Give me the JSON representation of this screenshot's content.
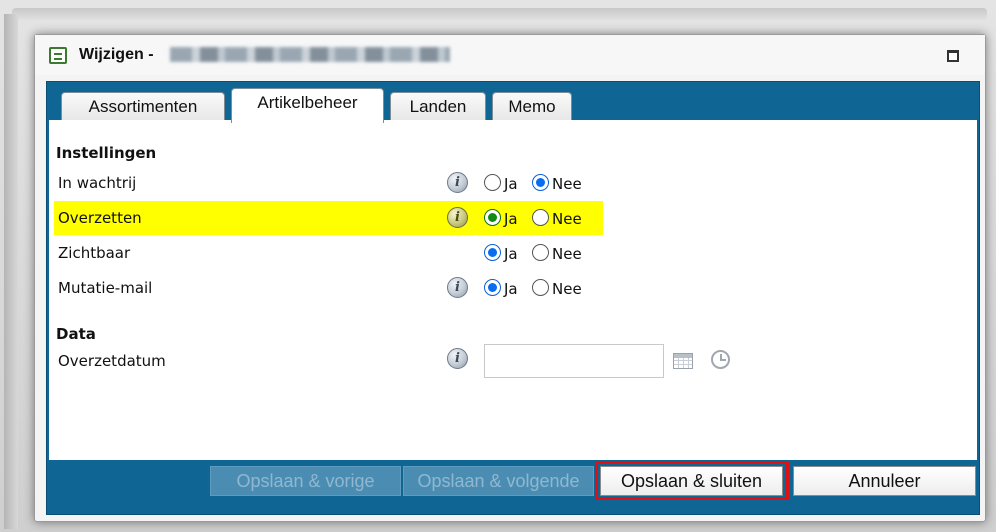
{
  "window": {
    "title": "Wijzigen -",
    "maximize_label": ""
  },
  "tabs": [
    {
      "label": "Assortimenten",
      "active": false
    },
    {
      "label": "Artikelbeheer",
      "active": true
    },
    {
      "label": "Landen",
      "active": false
    },
    {
      "label": "Memo",
      "active": false
    }
  ],
  "sections": {
    "settings_title": "Instellingen",
    "data_title": "Data"
  },
  "settings": [
    {
      "label": "In wachtrij",
      "info": true,
      "yes_label": "Ja",
      "no_label": "Nee",
      "value": "Nee",
      "highlight": false
    },
    {
      "label": "Overzetten",
      "info": true,
      "yes_label": "Ja",
      "no_label": "Nee",
      "value": "Ja",
      "highlight": true
    },
    {
      "label": "Zichtbaar",
      "info": false,
      "yes_label": "Ja",
      "no_label": "Nee",
      "value": "Ja",
      "highlight": false
    },
    {
      "label": "Mutatie-mail",
      "info": true,
      "yes_label": "Ja",
      "no_label": "Nee",
      "value": "Ja",
      "highlight": false
    }
  ],
  "data_fields": {
    "overzetdatum_label": "Overzetdatum",
    "overzetdatum_value": ""
  },
  "footer": {
    "save_prev": "Opslaan & vorige",
    "save_next": "Opslaan & volgende",
    "save_close": "Opslaan & sluiten",
    "cancel": "Annuleer"
  },
  "colors": {
    "panel_blue": "#0f6594",
    "highlight_yellow": "#ffff00",
    "callout_red": "#e01010"
  },
  "icons": {
    "info": "info-icon",
    "calendar": "calendar-icon",
    "clock": "clock-icon",
    "form": "form-icon",
    "maximize": "maximize-icon"
  }
}
